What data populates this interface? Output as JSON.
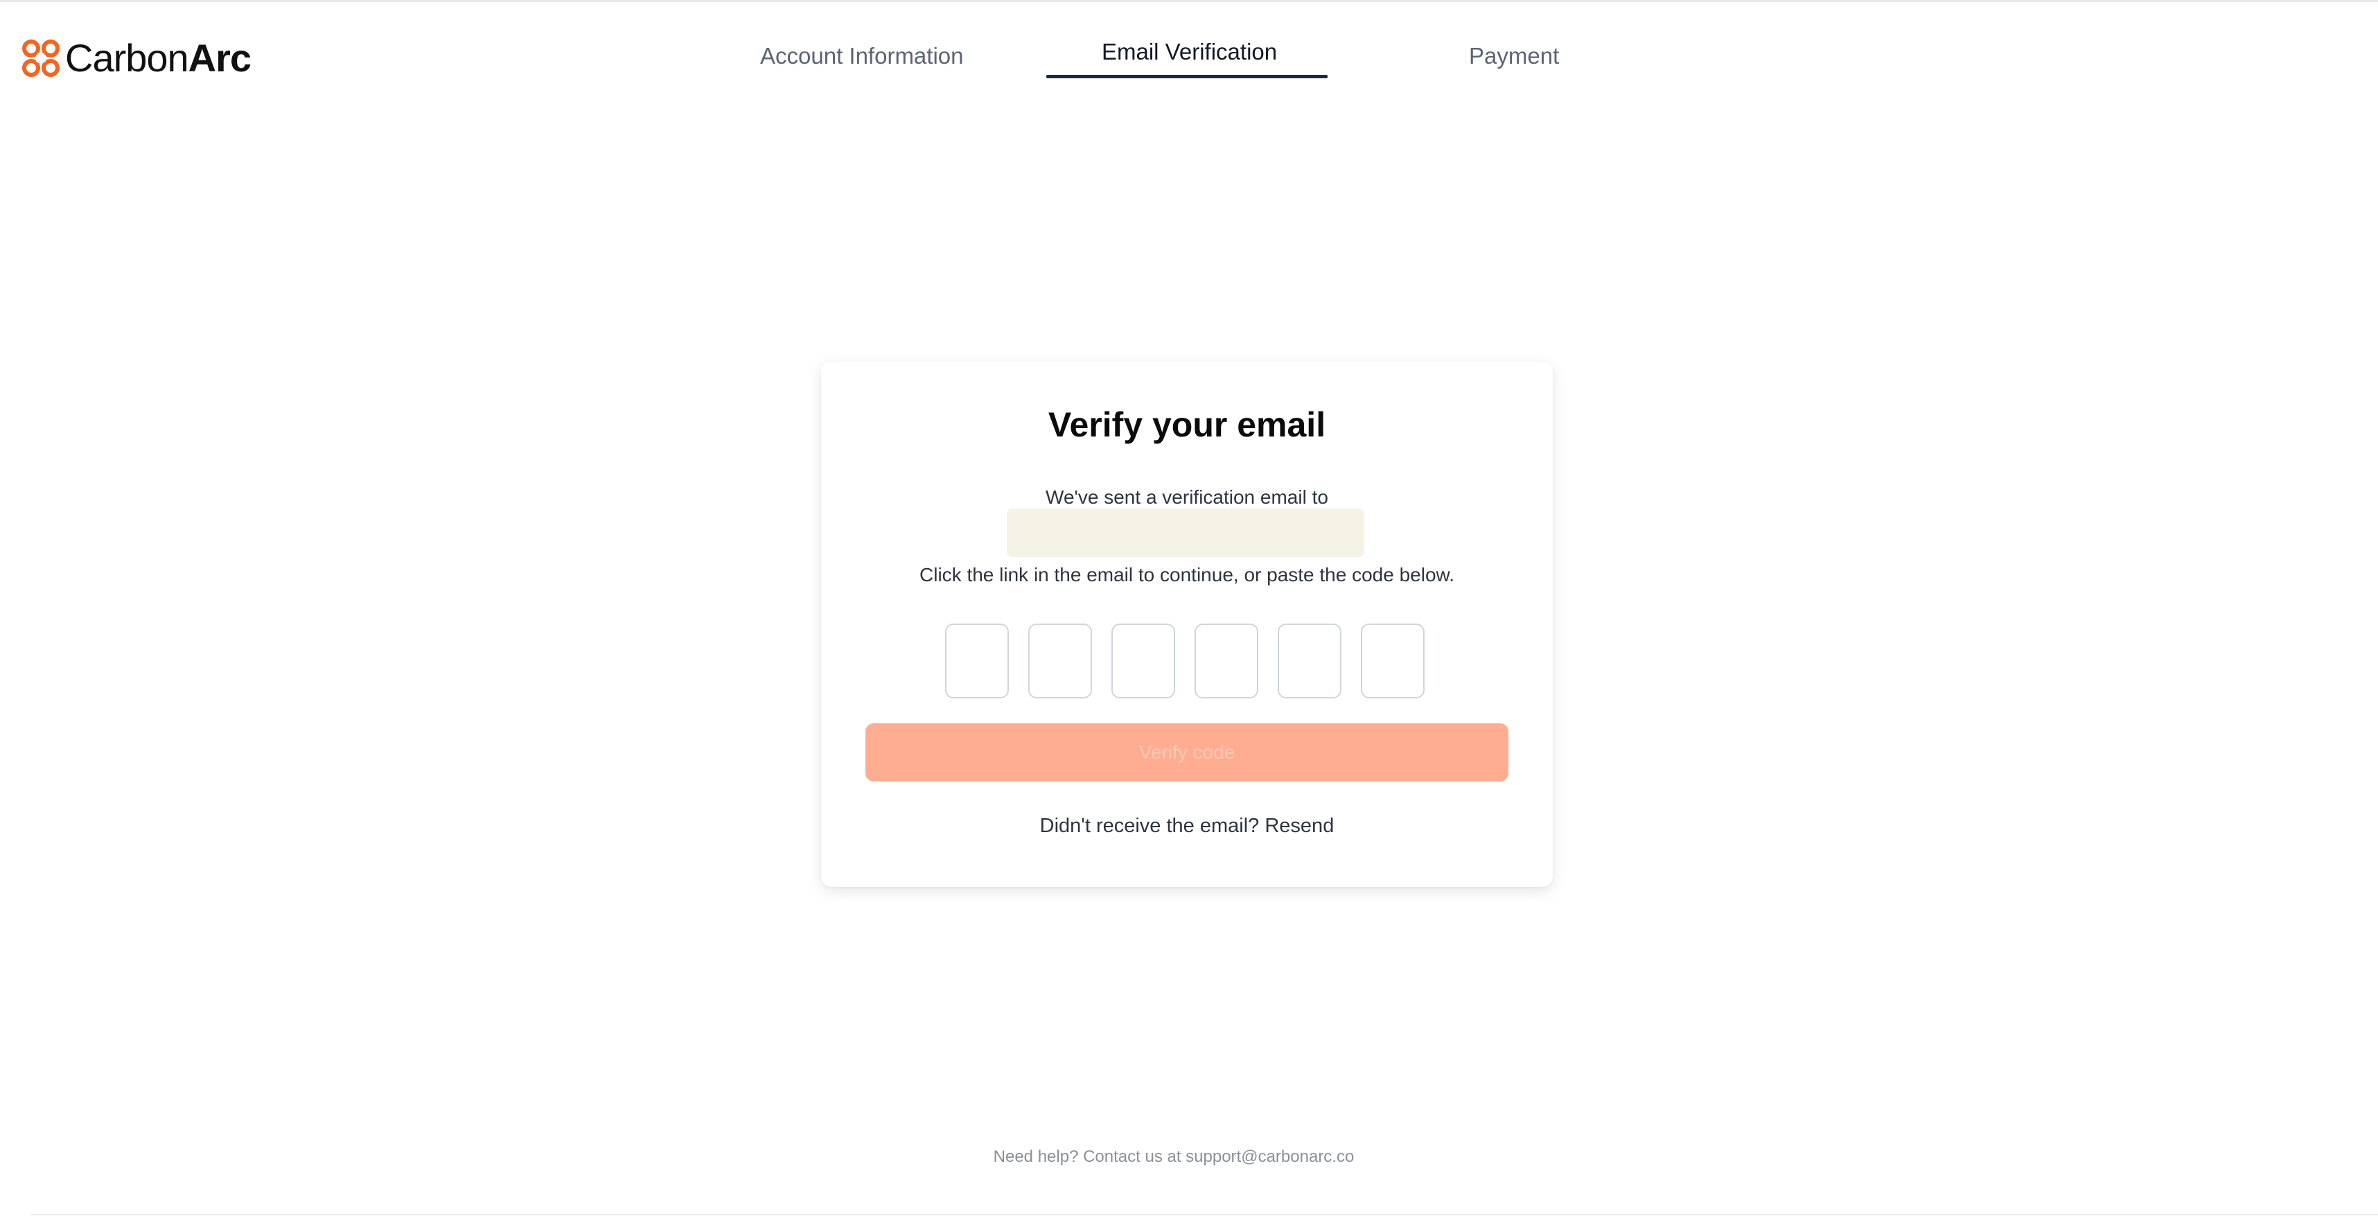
{
  "brand": {
    "name_light": "Carbon",
    "name_bold": "Arc",
    "accent_color": "#f26522"
  },
  "steps": {
    "account": "Account Information",
    "email": "Email Verification",
    "payment": "Payment",
    "active": "Email Verification"
  },
  "card": {
    "title": "Verify your email",
    "sent_text": "We've sent a verification email to",
    "email_value": "",
    "instruction": "Click the link in the email to continue, or paste the code below.",
    "code_digits": [
      "",
      "",
      "",
      "",
      "",
      ""
    ],
    "verify_button_label": "Verify code",
    "verify_button_color": "#ffad91",
    "resend_prompt": "Didn't receive the email?",
    "resend_link": "Resend"
  },
  "footer": {
    "help_text": "Need help? Contact us at support@carbonarc.co"
  }
}
